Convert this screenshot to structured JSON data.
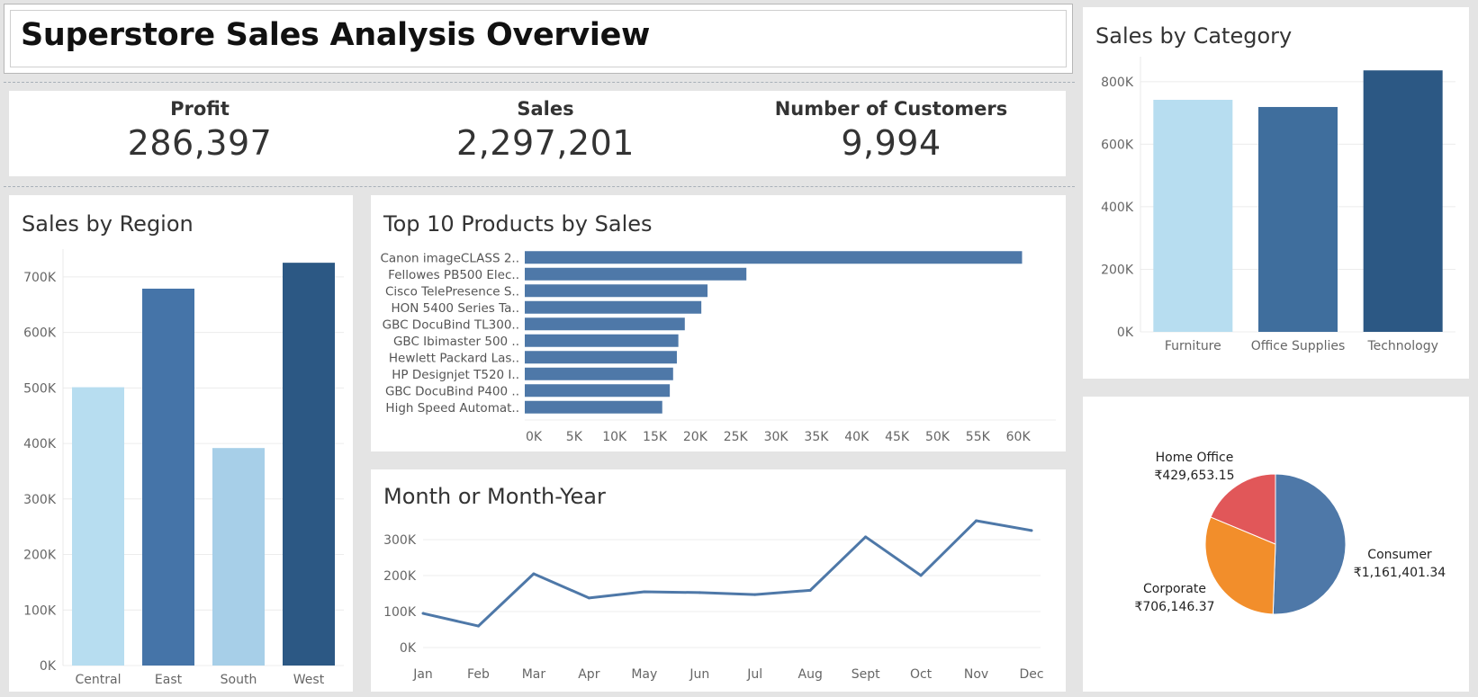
{
  "page_title": "Superstore Sales Analysis Overview",
  "kpis": [
    {
      "label": "Profit",
      "value": "286,397"
    },
    {
      "label": "Sales",
      "value": "2,297,201"
    },
    {
      "label": "Number of Customers",
      "value": "9,994"
    }
  ],
  "colors": {
    "light_blue": "#b7ddf0",
    "mid_blue": "#4574a8",
    "sky_blue": "#a7cfe8",
    "dark_blue": "#2c5884",
    "bar_blue": "#4e78a8",
    "orange": "#f28e2b",
    "red": "#e15759",
    "grid": "#ececec"
  },
  "chart_data": [
    {
      "id": "region",
      "type": "bar",
      "title": "Sales by Region",
      "categories": [
        "Central",
        "East",
        "South",
        "West"
      ],
      "values": [
        501240,
        678781,
        391722,
        725458
      ],
      "bar_colors": [
        "#b7ddf0",
        "#4574a8",
        "#a7cfe8",
        "#2c5884"
      ],
      "ylim": [
        0,
        750000
      ],
      "yticks": [
        0,
        100000,
        200000,
        300000,
        400000,
        500000,
        600000,
        700000
      ],
      "ytick_labels": [
        "0K",
        "100K",
        "200K",
        "300K",
        "400K",
        "500K",
        "600K",
        "700K"
      ]
    },
    {
      "id": "category",
      "type": "bar",
      "title": "Sales by Category",
      "categories": [
        "Furniture",
        "Office Supplies",
        "Technology"
      ],
      "values": [
        741999,
        719047,
        836154
      ],
      "bar_colors": [
        "#b7ddf0",
        "#3f6e9d",
        "#2c5884"
      ],
      "ylim": [
        0,
        880000
      ],
      "yticks": [
        0,
        200000,
        400000,
        600000,
        800000
      ],
      "ytick_labels": [
        "0K",
        "200K",
        "400K",
        "600K",
        "800K"
      ]
    },
    {
      "id": "products",
      "type": "bar",
      "orientation": "horizontal",
      "title": "Top 10 Products by Sales",
      "categories": [
        "Canon imageCLASS 2..",
        "Fellowes PB500 Elec..",
        "Cisco TelePresence S..",
        "HON 5400 Series Ta..",
        "GBC DocuBind TL300..",
        "GBC Ibimaster 500 ..",
        "Hewlett Packard Las..",
        "HP Designjet T520 I..",
        "GBC DocuBind P400 ..",
        "High Speed Automat.."
      ],
      "values": [
        61600,
        27453,
        22638,
        21870,
        19823,
        19025,
        18840,
        18375,
        17965,
        17030
      ],
      "bar_color": "#4e78a8",
      "xlim": [
        0,
        64000
      ],
      "xticks": [
        0,
        5000,
        10000,
        15000,
        20000,
        25000,
        30000,
        35000,
        40000,
        45000,
        50000,
        55000,
        60000
      ],
      "xtick_labels": [
        "0K",
        "5K",
        "10K",
        "15K",
        "20K",
        "25K",
        "30K",
        "35K",
        "40K",
        "45K",
        "50K",
        "55K",
        "60K"
      ]
    },
    {
      "id": "monthly",
      "type": "line",
      "title": "Month or Month-Year",
      "categories": [
        "Jan",
        "Feb",
        "Mar",
        "Apr",
        "May",
        "Jun",
        "Jul",
        "Aug",
        "Sept",
        "Oct",
        "Nov",
        "Dec"
      ],
      "values": [
        94925,
        59751,
        205005,
        137762,
        155029,
        152718,
        147238,
        159044,
        307650,
        200323,
        352461,
        325293
      ],
      "line_color": "#4e78a8",
      "ylim": [
        -10000,
        345000
      ],
      "yticks": [
        0,
        100000,
        200000,
        300000
      ],
      "ytick_labels": [
        "0K",
        "100K",
        "200K",
        "300K"
      ]
    },
    {
      "id": "segment",
      "type": "pie",
      "slices": [
        {
          "name": "Consumer",
          "value": 1161401.34,
          "label": "₹1,161,401.34",
          "color": "#4e78a8"
        },
        {
          "name": "Corporate",
          "value": 706146.37,
          "label": "₹706,146.37",
          "color": "#f28e2b"
        },
        {
          "name": "Home Office",
          "value": 429653.15,
          "label": "₹429,653.15",
          "color": "#e15759"
        }
      ]
    }
  ]
}
